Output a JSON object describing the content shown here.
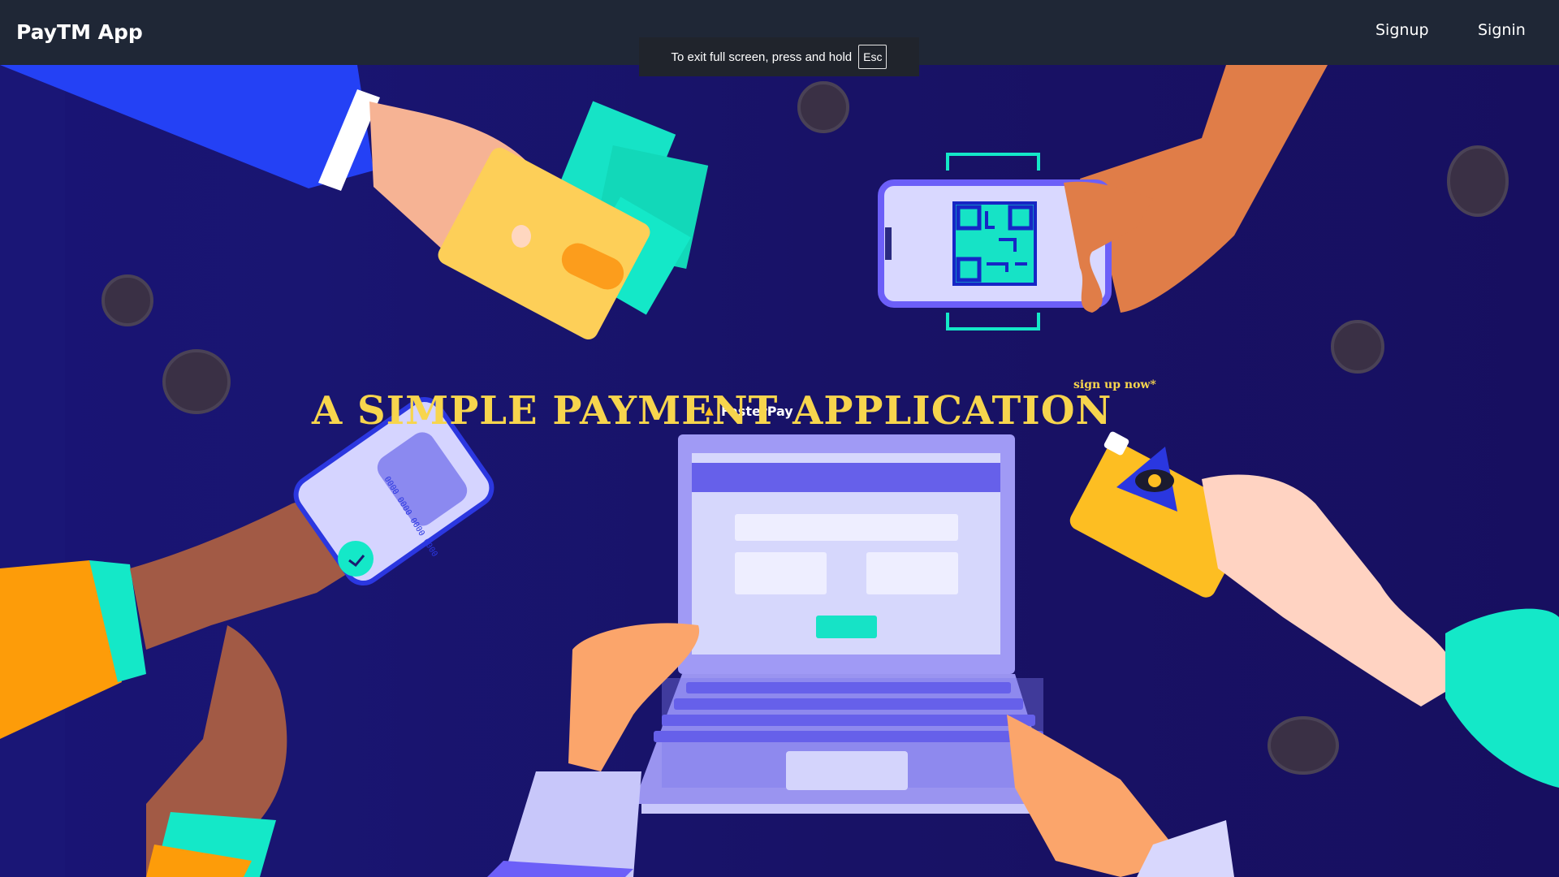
{
  "navbar": {
    "brand": "PayTM App",
    "links": [
      {
        "label": "Signup"
      },
      {
        "label": "Signin"
      }
    ]
  },
  "fullscreen_toast": {
    "message": "To exit full screen, press and hold",
    "key": "Esc"
  },
  "hero": {
    "headline": "A SIMPLE PAYMENT APPLICATION",
    "signup_hint": "sign up now*",
    "laptop_brand": "FasterPay",
    "card_number": "0000 0000 0000 0000"
  },
  "colors": {
    "navbar_bg": "#1f2736",
    "hero_bg": "#18165e",
    "headline": "#f7d54d",
    "accent_teal": "#14e8c8",
    "accent_purple": "#5c5cf0"
  }
}
